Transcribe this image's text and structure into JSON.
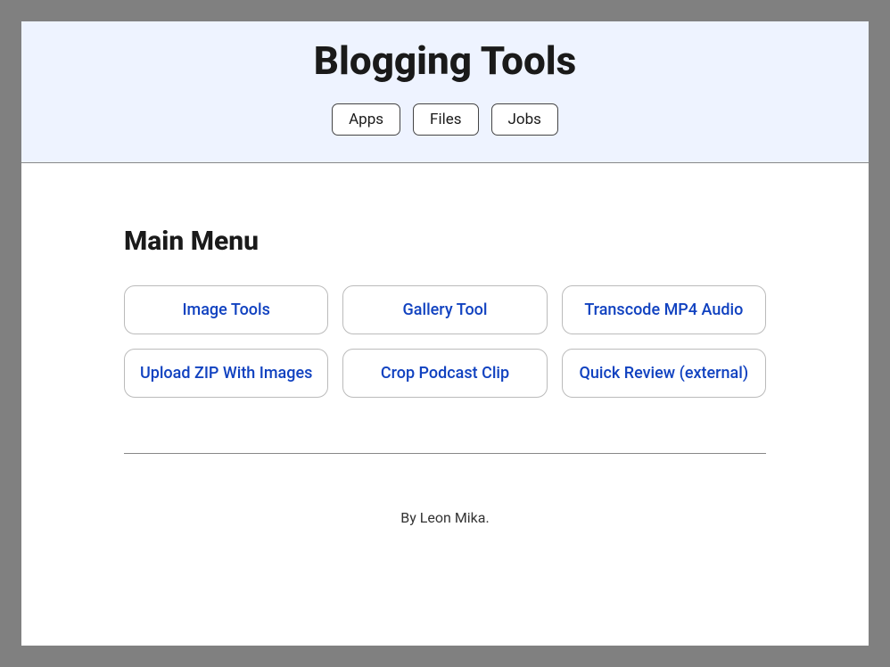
{
  "header": {
    "title": "Blogging Tools",
    "nav": [
      {
        "label": "Apps"
      },
      {
        "label": "Files"
      },
      {
        "label": "Jobs"
      }
    ]
  },
  "main": {
    "section_title": "Main Menu",
    "menu_items": [
      {
        "label": "Image Tools"
      },
      {
        "label": "Gallery Tool"
      },
      {
        "label": "Transcode MP4 Audio"
      },
      {
        "label": "Upload ZIP With Images"
      },
      {
        "label": "Crop Podcast Clip"
      },
      {
        "label": "Quick Review (external)"
      }
    ]
  },
  "footer": {
    "byline": "By Leon Mika."
  }
}
